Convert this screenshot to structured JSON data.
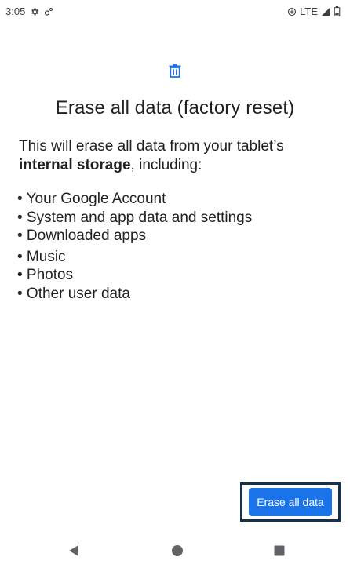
{
  "status_bar": {
    "time": "3:05",
    "network": "LTE",
    "icons": [
      "settings-gear-icon",
      "settings-small-icon",
      "data-saver-icon",
      "signal-icon",
      "battery-icon"
    ]
  },
  "header": {
    "icon": "trash-icon",
    "title": "Erase all data (factory reset)"
  },
  "description": {
    "intro": "This will erase all data from your tablet’s",
    "bold": "internal storage",
    "suffix": ", including:"
  },
  "items": [
    "• Your Google Account",
    "• System and app data and settings",
    "• Downloaded apps",
    "• Music",
    "• Photos",
    "• Other user data"
  ],
  "actions": {
    "erase_label": "Erase all data"
  },
  "nav": {
    "back": "back-icon",
    "home": "home-icon",
    "recents": "recents-icon"
  },
  "colors": {
    "accent": "#1a73e8",
    "highlight": "#16304f",
    "text": "#202124"
  }
}
